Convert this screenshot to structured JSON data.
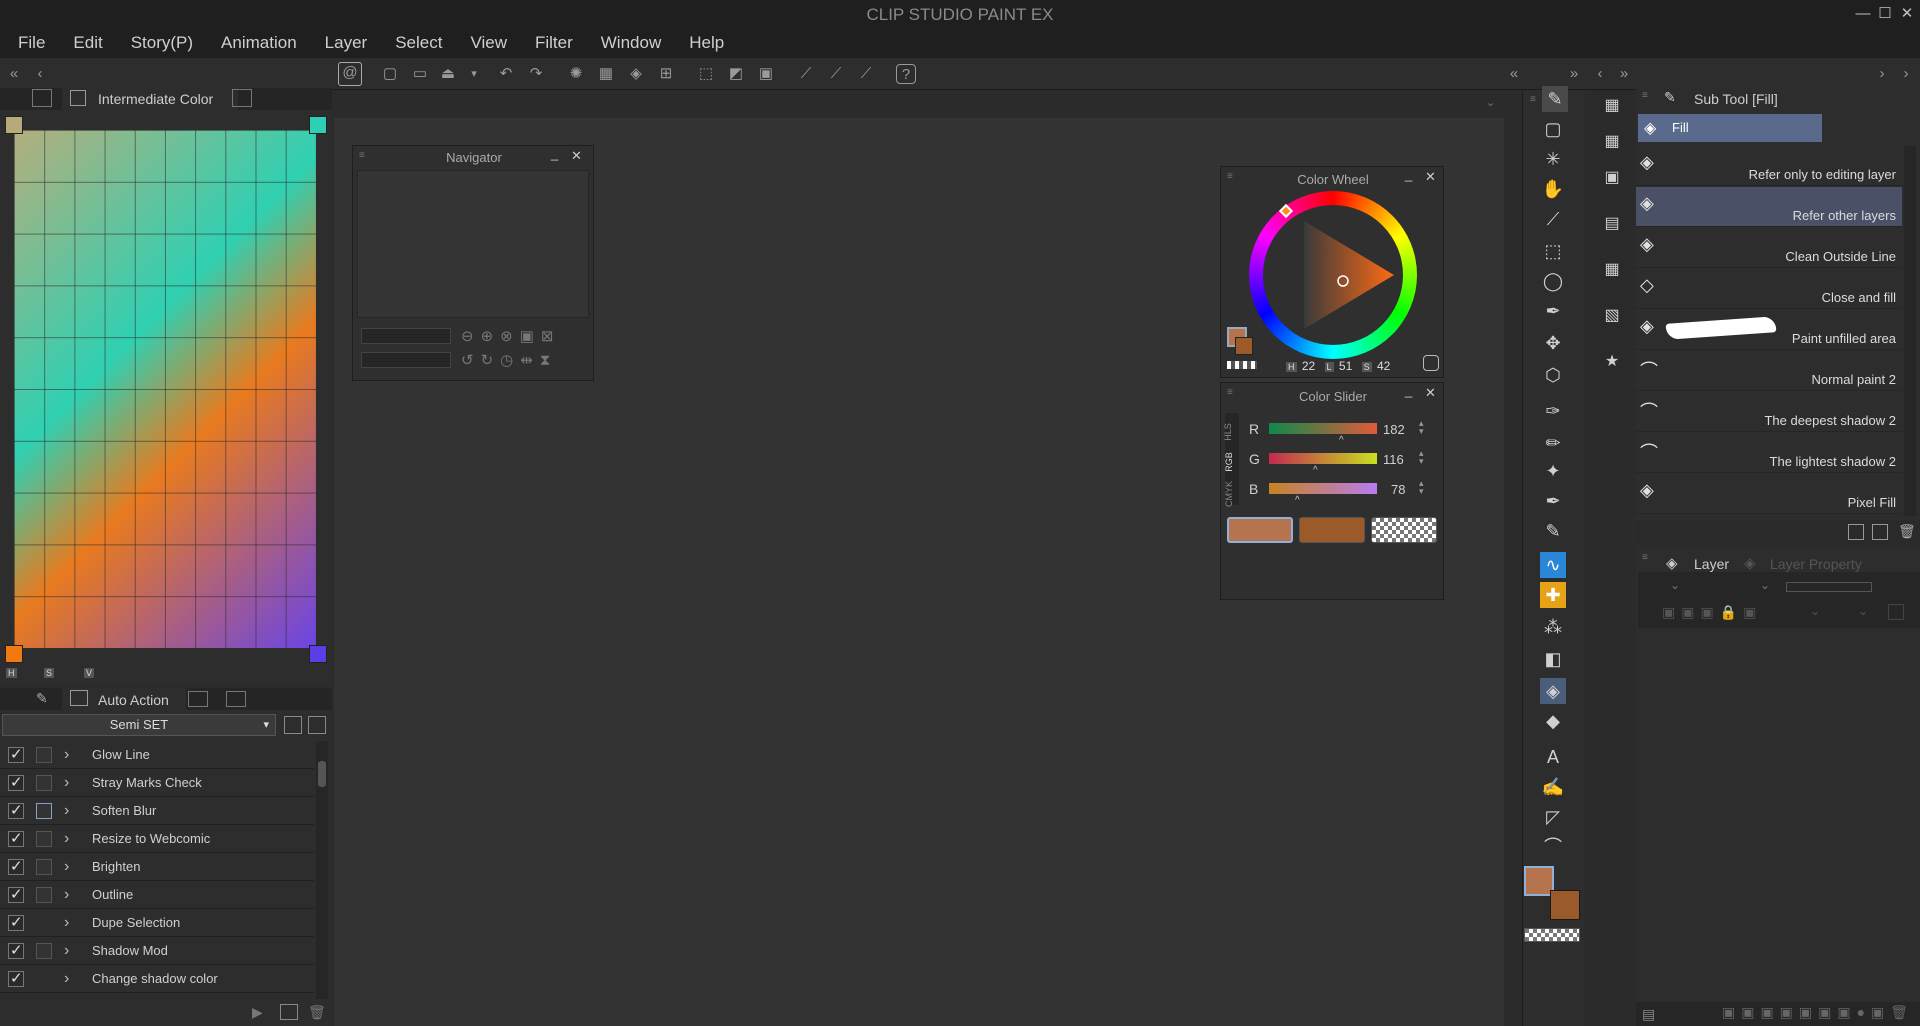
{
  "app": {
    "title": "CLIP STUDIO PAINT EX",
    "min": "—",
    "max": "☐",
    "close": "✕"
  },
  "menu": [
    "File",
    "Edit",
    "Story(P)",
    "Animation",
    "Layer",
    "Select",
    "View",
    "Filter",
    "Window",
    "Help"
  ],
  "intermediate": {
    "tab_label": "Intermediate Color",
    "axis_h": "H",
    "axis_s": "S",
    "axis_v": "V"
  },
  "auto_action": {
    "tab_label": "Auto Action",
    "set_name": "Semi SET",
    "items": [
      {
        "label": "Glow Line",
        "checked": true,
        "second": "box"
      },
      {
        "label": "Stray Marks Check",
        "checked": true,
        "second": "box"
      },
      {
        "label": "Soften Blur",
        "checked": true,
        "second": "icon"
      },
      {
        "label": "Resize to Webcomic",
        "checked": true,
        "second": "box"
      },
      {
        "label": "Brighten",
        "checked": true,
        "second": "box"
      },
      {
        "label": "Outline",
        "checked": true,
        "second": "box"
      },
      {
        "label": "Dupe Selection",
        "checked": true,
        "second": "none"
      },
      {
        "label": "Shadow Mod",
        "checked": true,
        "second": "box"
      },
      {
        "label": "Change shadow color",
        "checked": true,
        "second": "none"
      }
    ]
  },
  "navigator": {
    "title": "Navigator"
  },
  "color_wheel": {
    "title": "Color Wheel",
    "h_label": "H",
    "h": "22",
    "l_label": "L",
    "l": "51",
    "s_label": "S",
    "s": "42"
  },
  "color_slider": {
    "title": "Color Slider",
    "modes": [
      "HLS",
      "RGB",
      "CMYK"
    ],
    "r_label": "R",
    "r": "182",
    "g_label": "G",
    "g": "116",
    "b_label": "B",
    "b": "78"
  },
  "colors": {
    "main": "#b6744e",
    "sub": "#9a5a2a",
    "accent_blue": "#2a86d6",
    "accent_yellow": "#e6a318"
  },
  "sub_tool": {
    "title": "Sub Tool [Fill]",
    "group": "Fill",
    "items": [
      {
        "label": "Refer only to editing layer",
        "selected": false
      },
      {
        "label": "Refer other layers",
        "selected": true
      },
      {
        "label": "Clean Outside Line",
        "selected": false
      },
      {
        "label": "Close and fill",
        "selected": false
      },
      {
        "label": "Paint unfilled area",
        "selected": false
      },
      {
        "label": "Normal paint 2",
        "selected": false
      },
      {
        "label": "The deepest shadow 2",
        "selected": false
      },
      {
        "label": "The lightest shadow 2",
        "selected": false
      },
      {
        "label": "Pixel Fill",
        "selected": false
      }
    ]
  },
  "layer_panel": {
    "tab_layer": "Layer",
    "tab_property": "Layer Property"
  }
}
